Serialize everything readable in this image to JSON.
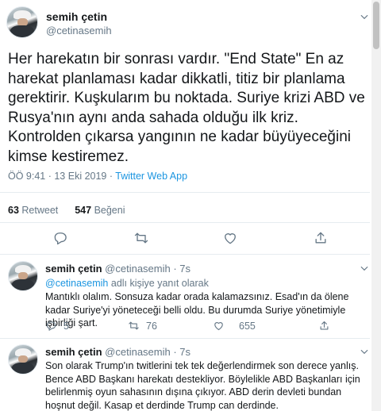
{
  "main_tweet": {
    "author_name": "semih çetin",
    "author_handle": "@cetinasemih",
    "text": "Her harekatın bir sonrası vardır. \"End State\" En az harekat planlaması kadar dikkatli, titiz bir planlama gerektirir. Kuşkularım bu noktada. Suriye krizi ABD ve Rusya'nın aynı anda sahada olduğu ilk kriz. Kontrolden çıkarsa yangının ne kadar büyüyeceğini kimse kestiremez.",
    "time_date": "ÖÖ 9:41 · 13 Eki 2019 · ",
    "source": "Twitter Web App",
    "retweet_count": "63",
    "retweet_label": "Retweet",
    "like_count": "547",
    "like_label": "Beğeni"
  },
  "replies": [
    {
      "author_name": "semih çetin",
      "author_handle": "@cetinasemih",
      "age": "· 7s",
      "replying_to_handle": "@cetinasemih",
      "replying_suffix": " adlı kişiye yanıt olarak",
      "text": "Mantıklı olalım. Sonsuza kadar orada kalamazsınız. Esad'ın  da ölene kadar Suriye'yi yöneteceği belli oldu. Bu durumda Suriye yönetimiyle işbirliği şart.",
      "reply_count": "5",
      "retweet_count": "76",
      "like_count": "655"
    },
    {
      "author_name": "semih çetin",
      "author_handle": "@cetinasemih",
      "age": "· 7s",
      "text": "Son olarak Trump'ın twitlerini tek tek değerlendirmek son derece yanlış. Bence ABD Başkanı harekatı destekliyor. Böylelikle ABD Başkanları için belirlenmiş oyun sahasının dışına çıkıyor. ABD derin devleti bundan hoşnut değil. Kasap et derdinde Trump can derdinde."
    }
  ],
  "icons": {
    "reply": "reply-icon",
    "retweet": "retweet-icon",
    "like": "heart-icon",
    "share": "share-icon",
    "more": "chevron-down-icon"
  },
  "colors": {
    "link": "#1b95e0",
    "secondary_text": "#657786",
    "divider": "#e6ecf0"
  }
}
